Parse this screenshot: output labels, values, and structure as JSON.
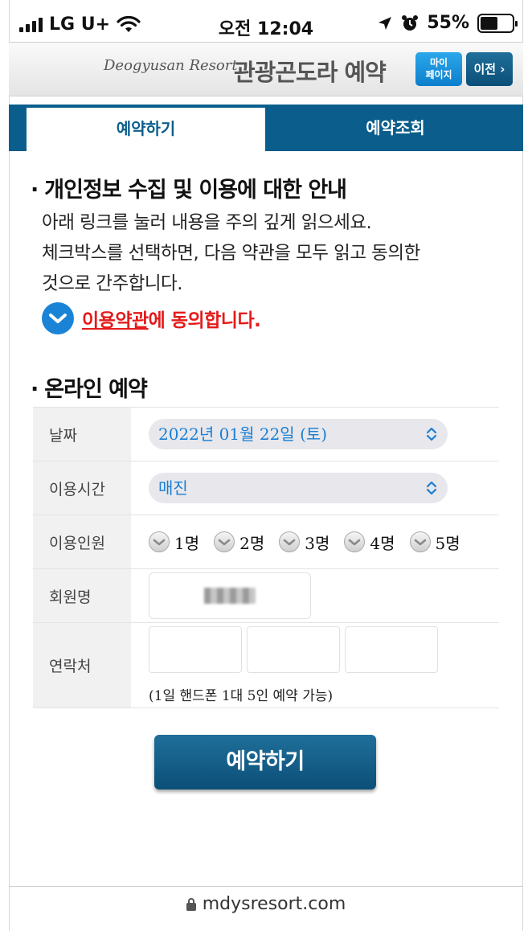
{
  "status_bar": {
    "carrier": "LG U+",
    "time": "오전 12:04",
    "battery": "55%",
    "battery_level": 0.55
  },
  "header": {
    "brand": "Deogyusan Resort",
    "title": "관광곤도라 예약",
    "mypage_line1": "마이",
    "mypage_line2": "페이지",
    "back_label": "이전 ›"
  },
  "tabs": {
    "reserve": "예약하기",
    "lookup": "예약조회"
  },
  "privacy": {
    "title": "개인정보 수집 및 이용에 대한 안내",
    "line1": "아래 링크를 눌러 내용을 주의 깊게 읽으세요.",
    "line2": "체크박스를 선택하면, 다음 약관을 모두 읽고 동의한",
    "line3": "것으로 간주합니다.",
    "agree_link": "이용약관",
    "agree_suffix": "에 동의합니다."
  },
  "online": {
    "title": "온라인 예약",
    "date_label": "날짜",
    "date_value": "2022년 01월 22일 (토)",
    "time_label": "이용시간",
    "time_value": "매진",
    "people_label": "이용인원",
    "people_options": [
      "1명",
      "2명",
      "3명",
      "4명",
      "5명"
    ],
    "member_label": "회원명",
    "contact_label": "연락처",
    "contact_note": "(1일 핸드폰 1대 5인 예약 가능)"
  },
  "submit_label": "예약하기",
  "url": "mdysresort.com"
}
